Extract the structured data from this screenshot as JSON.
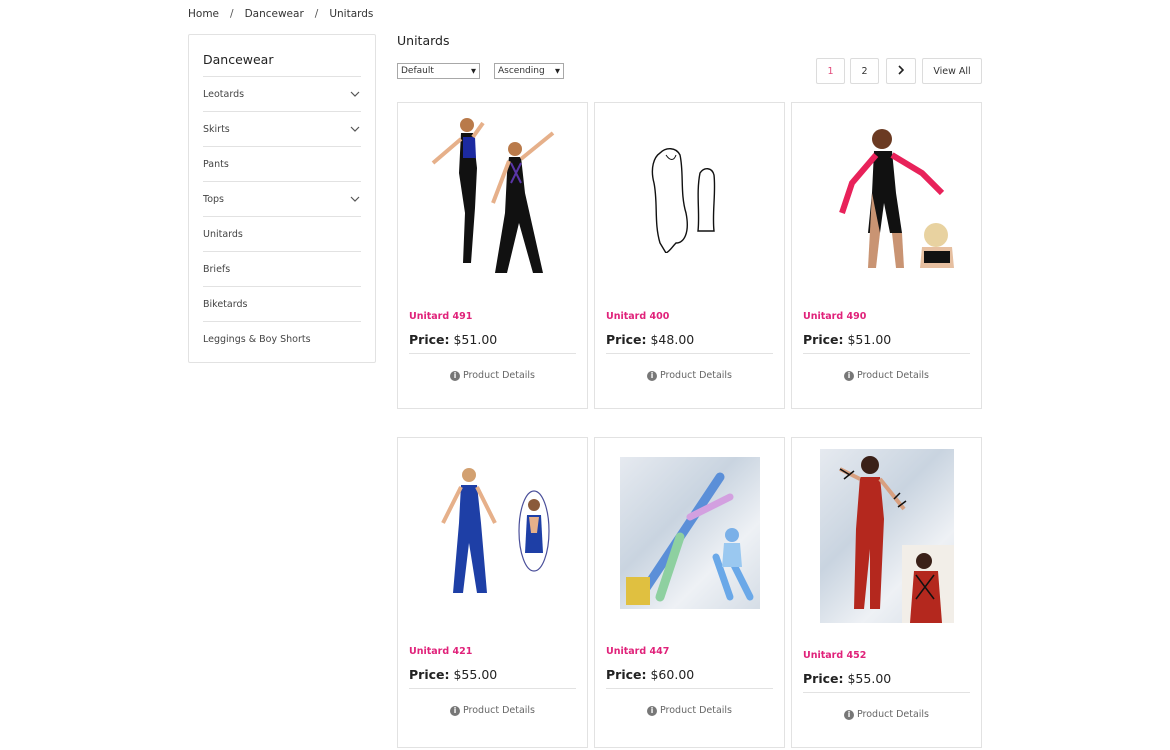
{
  "breadcrumb": [
    "Home",
    "Dancewear",
    "Unitards"
  ],
  "sidebar": {
    "title": "Dancewear",
    "items": [
      {
        "label": "Leotards",
        "expandable": true
      },
      {
        "label": "Skirts",
        "expandable": true
      },
      {
        "label": "Pants",
        "expandable": false
      },
      {
        "label": "Tops",
        "expandable": true
      },
      {
        "label": "Unitards",
        "expandable": false
      },
      {
        "label": "Briefs",
        "expandable": false
      },
      {
        "label": "Biketards",
        "expandable": false
      },
      {
        "label": "Leggings & Boy Shorts",
        "expandable": false
      }
    ]
  },
  "main": {
    "title": "Unitards",
    "sort_select": "Default",
    "order_select": "Ascending",
    "pagination": {
      "pages": [
        "1",
        "2"
      ],
      "current": "1",
      "view_all": "View All"
    }
  },
  "colors": {
    "accent_pink": "#e0227a",
    "border": "#e2e2e2"
  },
  "products": [
    {
      "name": "Unitard 491",
      "price_label": "Price:",
      "price": "$51.00",
      "details": "Product Details"
    },
    {
      "name": "Unitard 400",
      "price_label": "Price:",
      "price": "$48.00",
      "details": "Product Details"
    },
    {
      "name": "Unitard 490",
      "price_label": "Price:",
      "price": "$51.00",
      "details": "Product Details"
    },
    {
      "name": "Unitard 421",
      "price_label": "Price:",
      "price": "$55.00",
      "details": "Product Details"
    },
    {
      "name": "Unitard 447",
      "price_label": "Price:",
      "price": "$60.00",
      "details": "Product Details"
    },
    {
      "name": "Unitard 452",
      "price_label": "Price:",
      "price": "$55.00",
      "details": "Product Details"
    }
  ]
}
